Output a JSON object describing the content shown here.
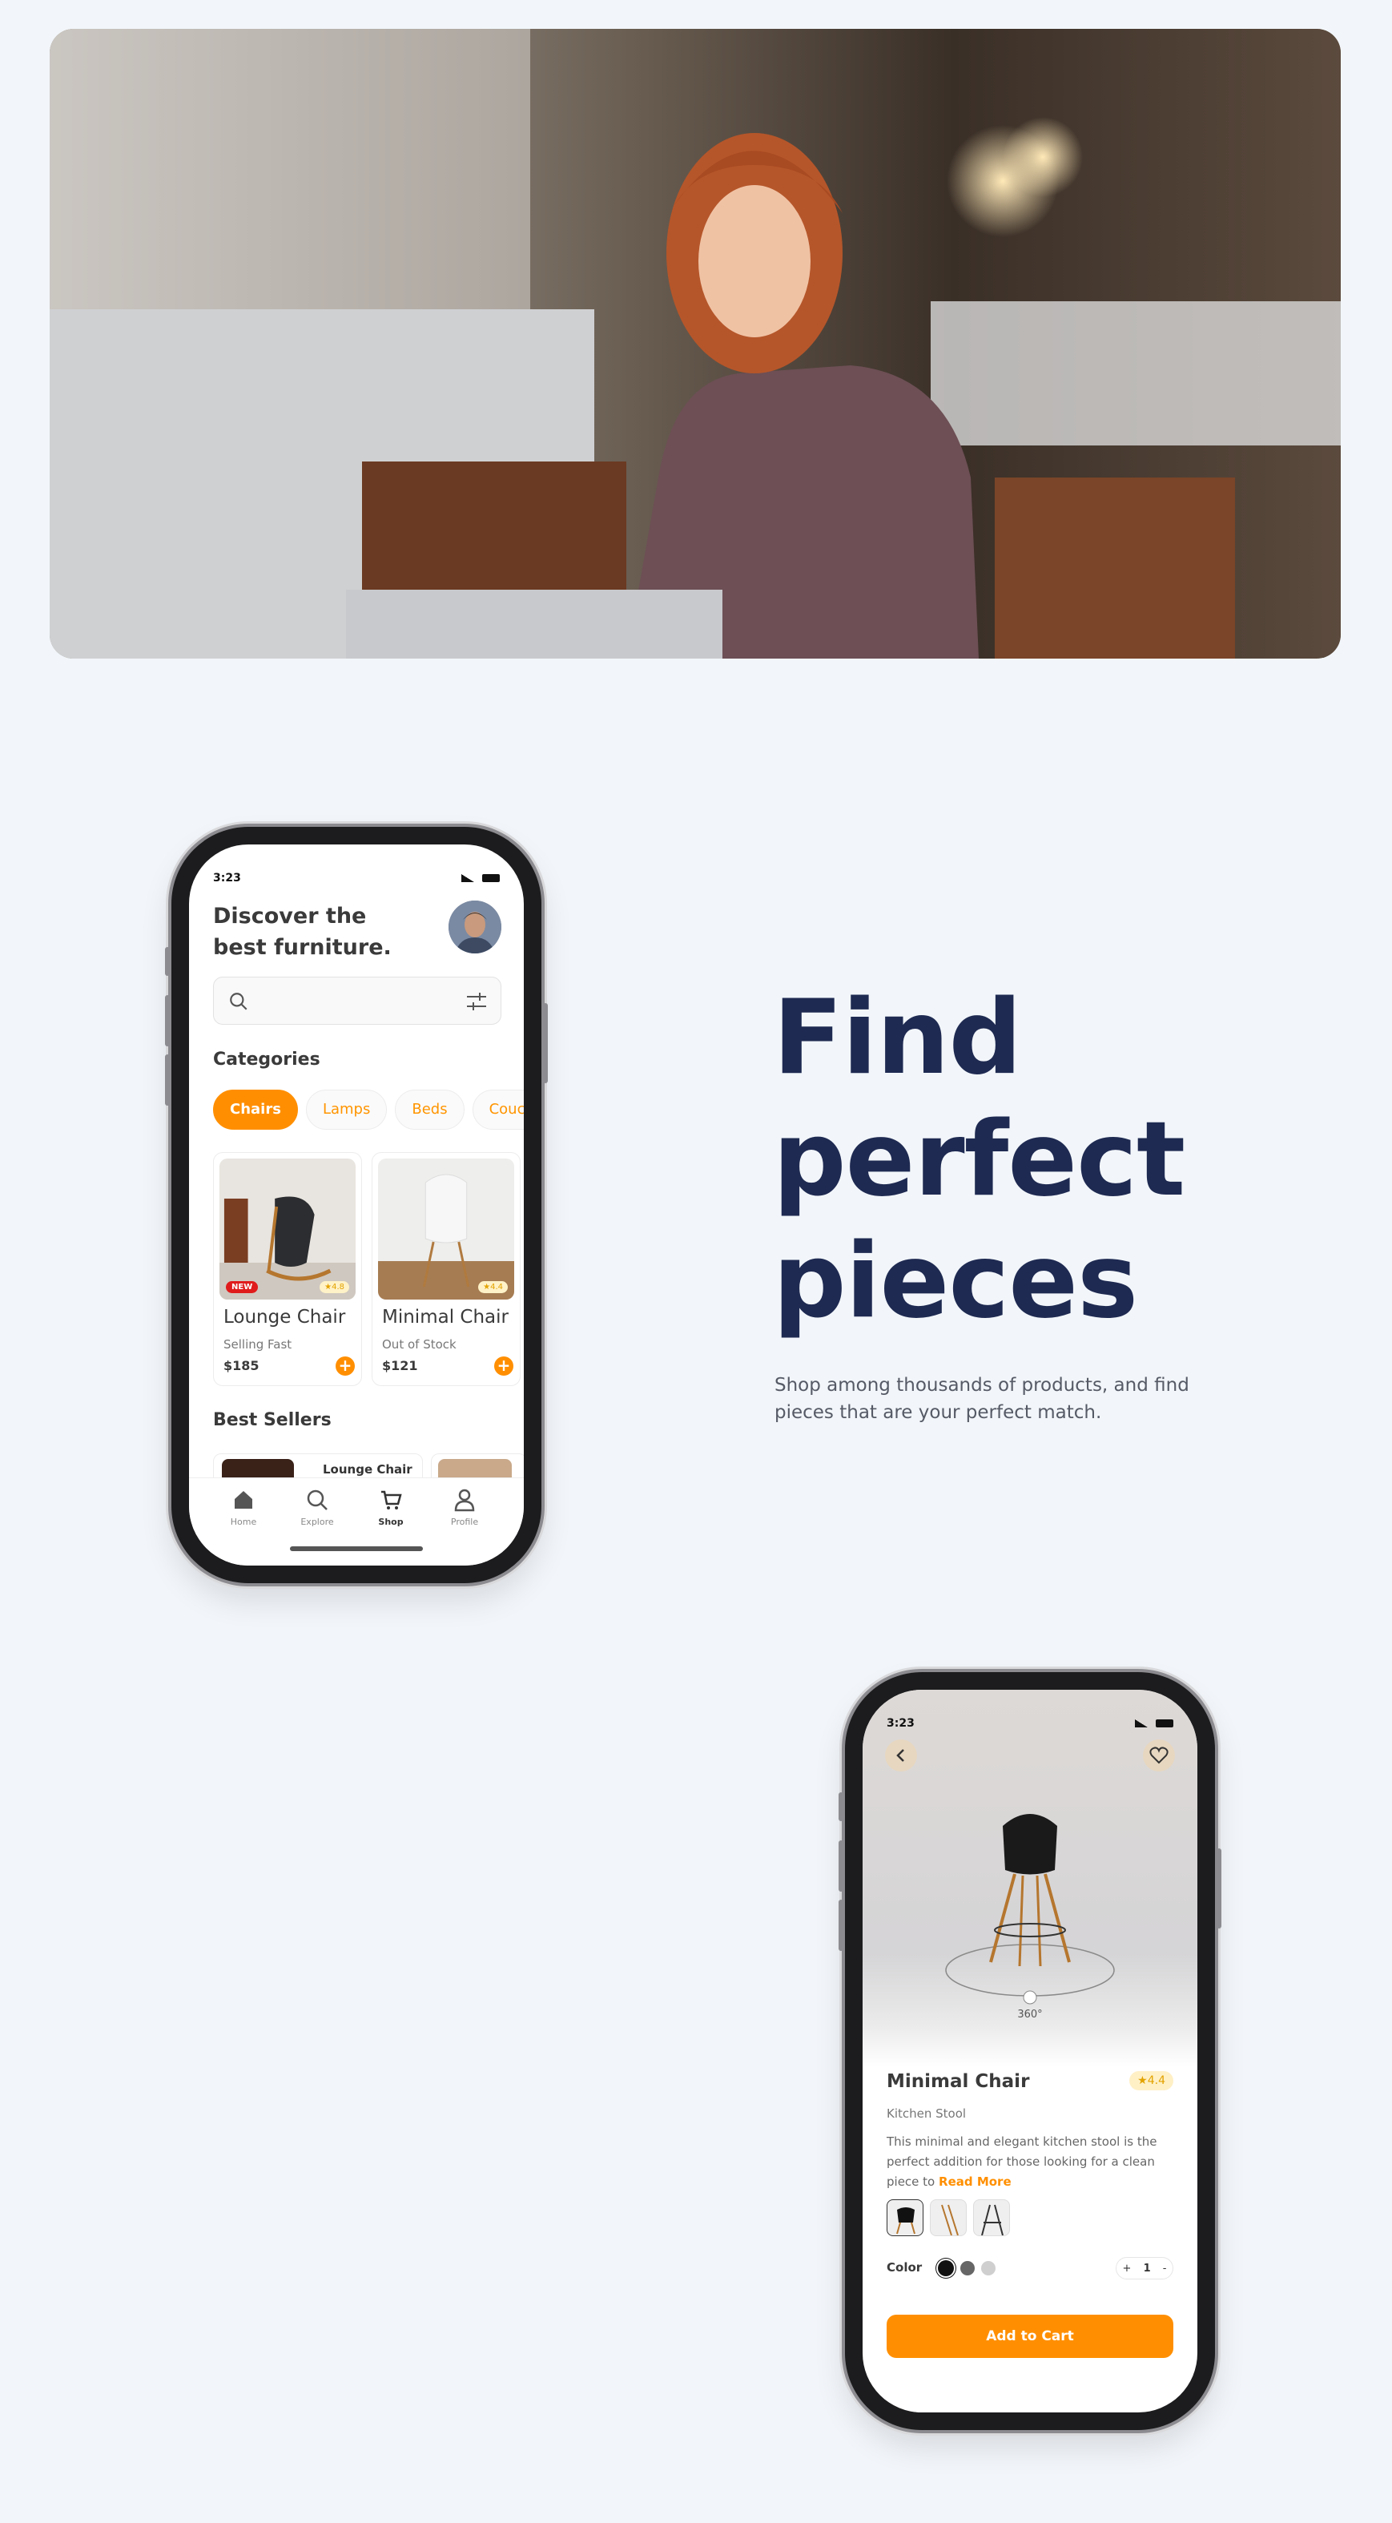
{
  "hero": {
    "alt_subject": "woman-using-laptop-photo"
  },
  "headline": {
    "line1": "Find",
    "line2": "perfect",
    "line3": "pieces"
  },
  "tagline": "Shop among thousands of products, and find pieces that are your perfect match.",
  "home_screen": {
    "status_time": "3:23",
    "title": "Discover the best furniture.",
    "search_placeholder": "",
    "categories_heading": "Categories",
    "categories": [
      "Chairs",
      "Lamps",
      "Beds",
      "Couch"
    ],
    "products": [
      {
        "name": "Lounge Chair",
        "status": "Selling Fast",
        "price": "$185",
        "badge": "NEW",
        "rating": "4.8"
      },
      {
        "name": "Minimal Chair",
        "status": "Out of Stock",
        "price": "$121",
        "rating": "4.4"
      }
    ],
    "best_sellers_heading": "Best Sellers",
    "best_sellers": [
      {
        "name": "Lounge Chair"
      }
    ],
    "tabs": [
      "Home",
      "Explore",
      "Shop",
      "Profile"
    ],
    "active_tab": "Shop"
  },
  "detail_screen": {
    "status_time": "3:23",
    "view_label": "360°",
    "title": "Minimal Chair",
    "rating": "4.4",
    "subtitle": "Kitchen Stool",
    "description": "This minimal and elegant kitchen stool is the perfect addition for those looking for a clean piece to",
    "read_more": "Read More",
    "color_label": "Color",
    "colors": [
      "#111111",
      "#666666",
      "#cfcfcf"
    ],
    "quantity": "1",
    "qty_minus": "-",
    "qty_plus": "+",
    "cta": "Add to Cart"
  },
  "colors": {
    "accent": "#ff8f00",
    "headline": "#1f2a52",
    "background": "#f2f6fa"
  }
}
